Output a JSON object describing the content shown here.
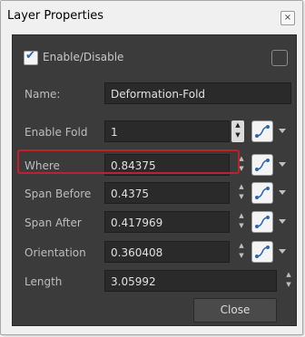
{
  "window": {
    "title": "Layer Properties"
  },
  "enable": {
    "label": "Enable/Disable",
    "checked": true
  },
  "fields": [
    {
      "label": "Name:",
      "value": "Deformation-Fold"
    },
    {
      "label": "Enable Fold",
      "value": "1"
    },
    {
      "label": "Where",
      "value": "0.84375"
    },
    {
      "label": "Span Before",
      "value": "0.4375"
    },
    {
      "label": "Span After",
      "value": "0.417969"
    },
    {
      "label": "Orientation",
      "value": "0.360408"
    },
    {
      "label": "Length",
      "value": "3.05992"
    }
  ],
  "buttons": {
    "close": "Close"
  },
  "colors": {
    "panel": "#3b3b3b",
    "field": "#2a2a2a",
    "accent": "#2b66b8",
    "highlight": "#c0202a"
  }
}
